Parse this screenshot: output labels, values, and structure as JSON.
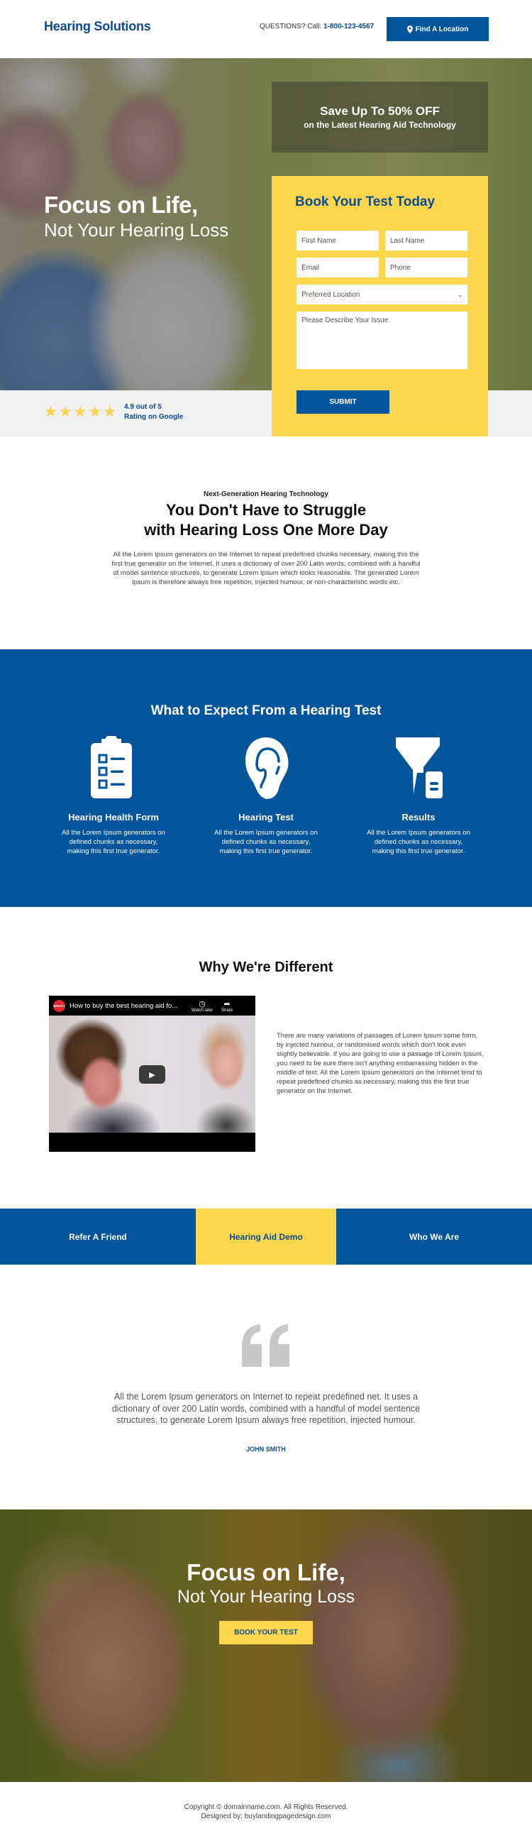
{
  "header": {
    "logo": "Hearing Solutions",
    "phone_label": "QUESTIONS? Call:",
    "phone_number": "1-800-123-4567",
    "find_location": "Find A Location"
  },
  "hero": {
    "title_line1": "Focus on Life,",
    "title_line2": "Not Your Hearing Loss",
    "promo_line1": "Save Up To 50% OFF",
    "promo_line2": "on the Latest Hearing Aid Technology",
    "rating_value": "4.9 out of 5",
    "rating_source": "Rating on Google",
    "stars": 5
  },
  "form": {
    "title": "Book Your Test Today",
    "first_name": "First Name",
    "last_name": "Last Name",
    "email": "Email",
    "phone": "Phone",
    "location": "Preferred Location",
    "issue": "Please Describe Your Issue",
    "submit": "SUBMIT"
  },
  "intro": {
    "eyebrow": "Next-Generation Hearing Technology",
    "title_line1": "You Don't Have to Struggle",
    "title_line2": "with Hearing Loss One More Day",
    "body": "All the Lorem Ipsum generators on the Internet to repeat predefined chunks necessary, making this the first true generator on the Internet. It uses a dictionary of over 200 Latin words, combined with a handful of model sentence structures, to generate Lorem Ipsum which looks reasonable. The generated Lorem Ipsum is therefore always free repetition, injected humour, or non-characteristic words etc."
  },
  "expect": {
    "title": "What to Expect From a Hearing Test",
    "features": [
      {
        "icon": "clipboard-checklist-icon",
        "title": "Hearing Health Form",
        "body": "All the Lorem Ipsum generators on defined chunks as necessary, making this first true generator."
      },
      {
        "icon": "ear-icon",
        "title": "Hearing Test",
        "body": "All the Lorem Ipsum generators on defined chunks as necessary, making this first true generator."
      },
      {
        "icon": "funnel-results-icon",
        "title": "Results",
        "body": "All the Lorem Ipsum generators on defined chunks as necessary, making this first true generator."
      }
    ]
  },
  "why": {
    "title": "Why We're Different",
    "video": {
      "channel": "Which?",
      "title": "How to buy the best hearing aid fo...",
      "watch_later": "Watch later",
      "share": "Share"
    },
    "body": "There are many variations of passages of Lorem Ipsum some form, by injected humour, or randomised words which don't look even slightly believable. If you are going to use a passage of Lorem Ipsum, you need to be sure there isn't anything embarrassing hidden in the middle of text. All the Lorem Ipsum generators on the Internet tend to repeat predefined chunks as necessary, making this the first true generator on the Internet."
  },
  "tabs": [
    {
      "label": "Refer A Friend",
      "active": false
    },
    {
      "label": "Hearing Aid Demo",
      "active": true
    },
    {
      "label": "Who We Are",
      "active": false
    }
  ],
  "testimonial": {
    "quote": "All the Lorem Ipsum generators on Internet to repeat predefined net. It uses a dictionary of over 200 Latin words, combined with a handful of model sentence structures, to generate Lorem Ipsum always free repetition, injected humour.",
    "author": "JOHN SMITH"
  },
  "cta": {
    "title_line1": "Focus on Life,",
    "title_line2": "Not Your Hearing Loss",
    "button": "BOOK YOUR TEST"
  },
  "footer": {
    "copyright": "Copyright © domainname.com. All Rights Reserved.",
    "designed_by": "Designed by: buylandingpagedesign.com"
  },
  "colors": {
    "brand_blue": "#02559a",
    "accent_yellow": "#fcd64c",
    "star_yellow": "#fcd34d"
  }
}
